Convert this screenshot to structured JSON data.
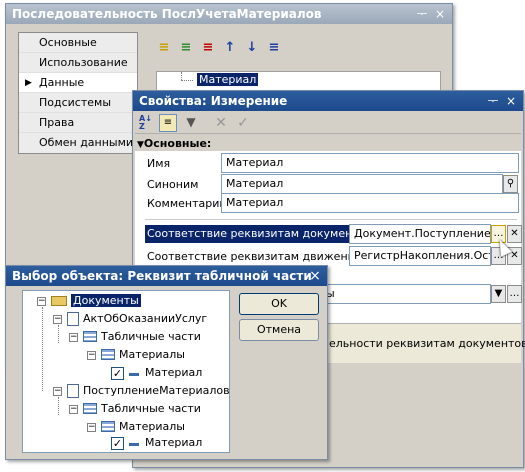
{
  "seq_window": {
    "title": "Последовательность ПослУчетаМатериалов",
    "pin_icon": "ᅮ",
    "close_icon": "×",
    "nav_items": [
      "Основные",
      "Использование",
      "Данные",
      "Подсистемы",
      "Права",
      "Обмен данными"
    ],
    "selected_nav": "Данные",
    "tree_item": "Материал"
  },
  "props_window": {
    "title": "Свойства: Измерение",
    "section": "Основные:",
    "name_label": "Имя",
    "name_value": "Материал",
    "synonym_label": "Синоним",
    "synonym_value": "Материал",
    "comment_label": "Комментарий",
    "comment_value": "Материал",
    "docs_label": "Соответствие реквизитам документов",
    "docs_value": "Документ.ПоступлениеМат",
    "moves_label": "Соответствие реквизитам движений",
    "moves_value": "РегистрНакопления.Остат",
    "partial_value": "ы",
    "desc_partial": "ельности реквизитам документов,"
  },
  "select_dialog": {
    "title": "Выбор объекта: Реквизит табличной части",
    "ok_label": "OK",
    "cancel_label": "Отмена",
    "tree": {
      "root": "Документы",
      "doc1": "АктОбОказанииУслуг",
      "tab1": "Табличные части",
      "mat1": "Материалы",
      "attr1": "Материал",
      "doc2": "ПоступлениеМатериалов",
      "tab2": "Табличные части",
      "mat2": "Материалы",
      "attr2": "Материал"
    }
  },
  "colors": {
    "title_blue": "#1c4a8c",
    "title_gray": "#9aa8b8",
    "selection": "#0a246a"
  }
}
